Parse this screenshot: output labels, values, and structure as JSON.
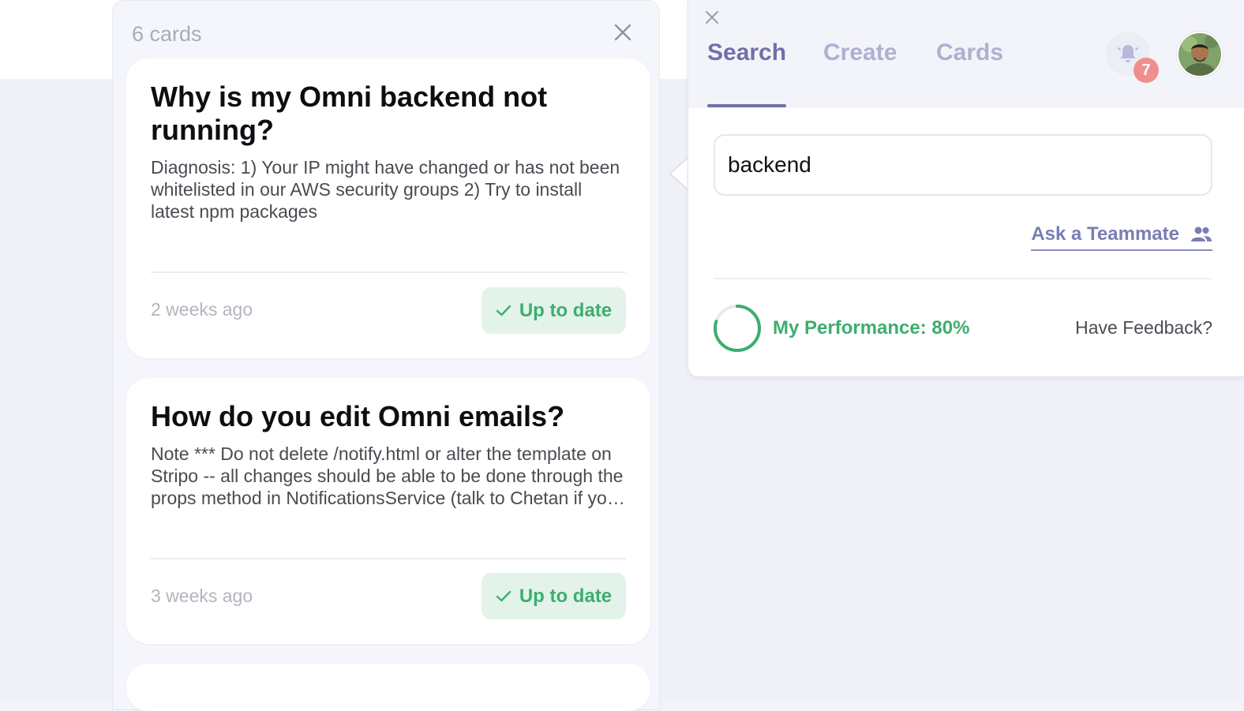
{
  "cards_panel": {
    "count_label": "6 cards",
    "close_icon": "close-icon",
    "cards": [
      {
        "title": "Why is my Omni backend not running?",
        "body": "Diagnosis: 1) Your IP might have changed or has not been whitelisted in our AWS security groups 2) Try to install latest npm packages",
        "date": "2 weeks ago",
        "status": "Up to date"
      },
      {
        "title": "How do you edit Omni emails?",
        "body": "Note *** Do not delete /notify.html or alter the template on Stripo -- all changes should be able to be done through the props method in NotificationsService (talk to Chetan if you have questions)",
        "date": "3 weeks ago",
        "status": "Up to date"
      }
    ]
  },
  "search_panel": {
    "close_icon": "close-icon",
    "tabs": [
      {
        "label": "Search",
        "active": true
      },
      {
        "label": "Create",
        "active": false
      },
      {
        "label": "Cards",
        "active": false
      }
    ],
    "notifications": {
      "icon": "bell-icon",
      "count": "7"
    },
    "avatar_icon": "user-avatar",
    "search_value": "backend",
    "ask_teammate": {
      "label": "Ask a Teammate",
      "icon": "people-icon"
    },
    "performance": {
      "label": "My Performance: 80%",
      "value": 0.8
    },
    "feedback_label": "Have Feedback?"
  },
  "colors": {
    "accent": "#6e71a8",
    "tab_inactive": "#aeb0d0",
    "success": "#3cae6e",
    "success_bg": "#e3f3ea",
    "badge": "#f08e8e"
  }
}
